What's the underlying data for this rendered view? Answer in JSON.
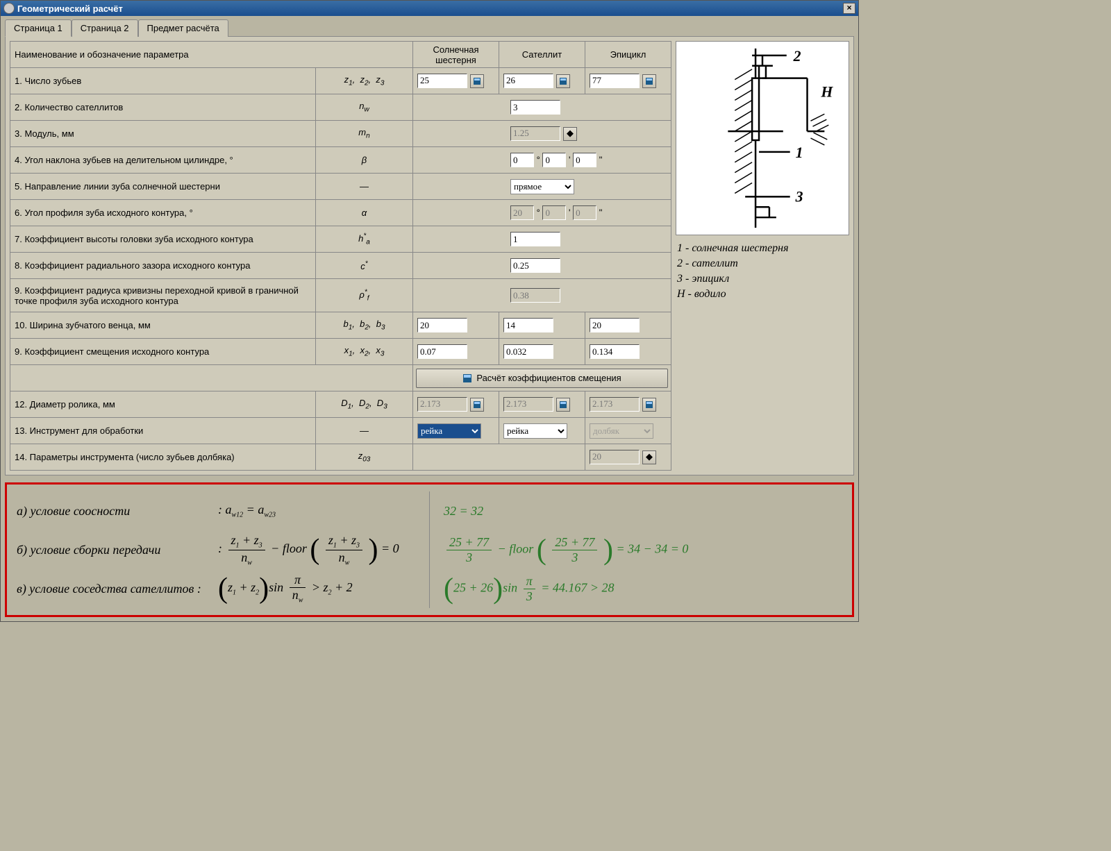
{
  "window": {
    "title": "Геометрический расчёт"
  },
  "tabs": [
    "Страница 1",
    "Страница 2",
    "Предмет расчёта"
  ],
  "header": {
    "name": "Наименование и обозначение параметра",
    "c1": "Солнечная шестерня",
    "c2": "Сателлит",
    "c3": "Эпицикл"
  },
  "rows": {
    "r1": {
      "label": "1. Число зубьев",
      "sym": "z₁,  z₂,  z₃",
      "v1": "25",
      "v2": "26",
      "v3": "77"
    },
    "r2": {
      "label": "2. Количество сателлитов",
      "sym": "nw",
      "v": "3"
    },
    "r3": {
      "label": "3. Модуль, мм",
      "sym": "mn",
      "v": "1.25"
    },
    "r4": {
      "label": "4. Угол наклона зубьев на делительном цилиндре, °",
      "sym": "β",
      "d": "0",
      "m": "0",
      "s": "0"
    },
    "r5": {
      "label": "5. Направление линии зуба солнечной шестерни",
      "sym": "—",
      "v": "прямое"
    },
    "r6": {
      "label": "6. Угол профиля зуба исходного контура, °",
      "sym": "α",
      "d": "20",
      "m": "0",
      "s": "0"
    },
    "r7": {
      "label": "7. Коэффициент высоты головки зуба исходного контура",
      "sym": "h*a",
      "v": "1"
    },
    "r8": {
      "label": "8. Коэффициент радиального зазора исходного контура",
      "sym": "c*",
      "v": "0.25"
    },
    "r9": {
      "label": "9. Коэффициент радиуса кривизны переходной кривой в граничной точке профиля зуба исходного контура",
      "sym": "ρ*f",
      "v": "0.38"
    },
    "r10": {
      "label": "10. Ширина зубчатого венца, мм",
      "sym": "b₁,  b₂,  b₃",
      "v1": "20",
      "v2": "14",
      "v3": "20"
    },
    "r11": {
      "label": "9. Коэффициент смещения исходного контура",
      "sym": "x₁,  x₂,  x₃",
      "v1": "0.07",
      "v2": "0.032",
      "v3": "0.134"
    },
    "btn": {
      "label": "Расчёт коэффициентов смещения"
    },
    "r12": {
      "label": "12. Диаметр ролика, мм",
      "sym": "D₁,  D₂,  D₃",
      "v1": "2.173",
      "v2": "2.173",
      "v3": "2.173"
    },
    "r13": {
      "label": "13. Инструмент для обработки",
      "sym": "—",
      "v1": "рейка",
      "v2": "рейка",
      "v3": "долбяк"
    },
    "r14": {
      "label": "14. Параметры инструмента (число зубьев долбяка)",
      "sym": "z03",
      "v": "20"
    }
  },
  "legend": {
    "l1": "1 - солнечная шестерня",
    "l2": "2 - сателлит",
    "l3": "3 - эпицикл",
    "l4": "Н - водило"
  },
  "formulas": {
    "a_label": "а) условие соосности",
    "a_expr": ": aw12 = aw23",
    "a_res": "32 = 32",
    "b_label": "б) условие сборки передачи",
    "c_label": "в) условие соседства сателлитов :"
  }
}
